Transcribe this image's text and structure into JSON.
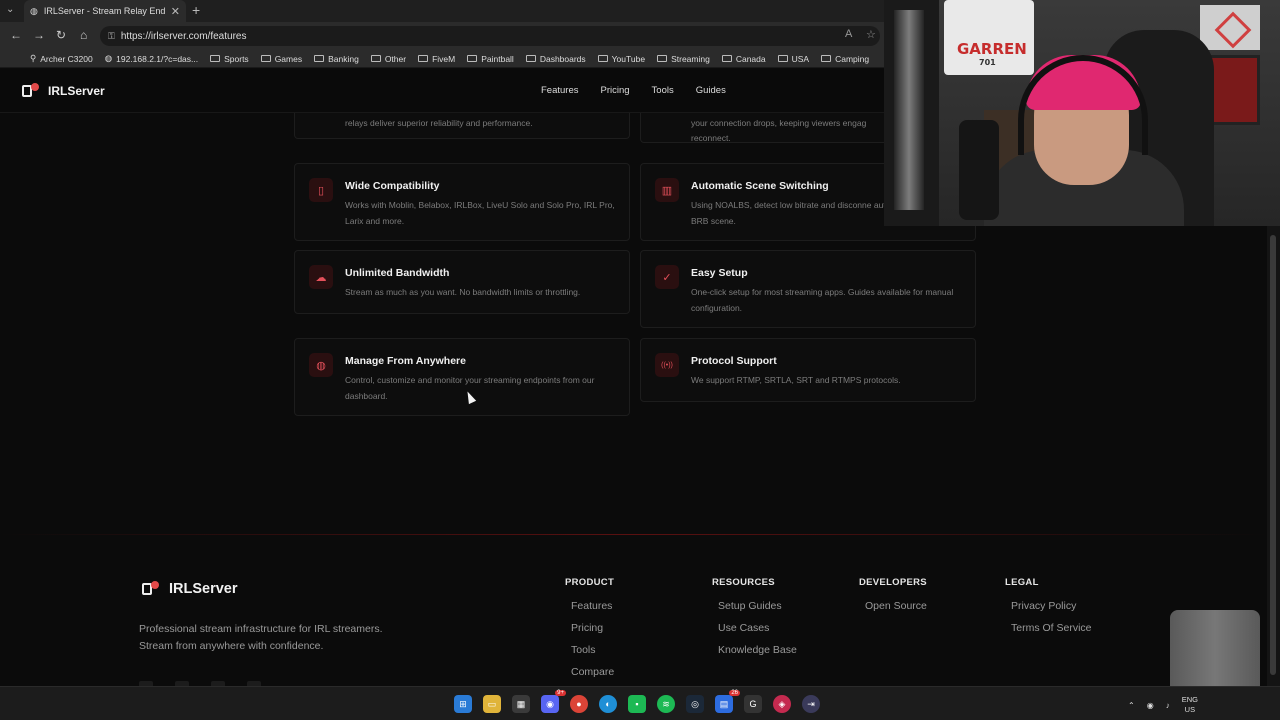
{
  "browser": {
    "tab_title": "IRLServer - Stream Relay Endpoin",
    "url": "https://irlserver.com/features",
    "bookmarks": [
      {
        "label": "Archer C3200",
        "icon": "router-icon"
      },
      {
        "label": "192.168.2.1/?c=das...",
        "icon": "globe-icon"
      },
      {
        "label": "Sports",
        "icon": "folder-icon"
      },
      {
        "label": "Games",
        "icon": "folder-icon"
      },
      {
        "label": "Banking",
        "icon": "folder-icon"
      },
      {
        "label": "Other",
        "icon": "folder-icon"
      },
      {
        "label": "FiveM",
        "icon": "folder-icon"
      },
      {
        "label": "Paintball",
        "icon": "folder-icon"
      },
      {
        "label": "Dashboards",
        "icon": "folder-icon"
      },
      {
        "label": "YouTube",
        "icon": "folder-icon"
      },
      {
        "label": "Streaming",
        "icon": "folder-icon"
      },
      {
        "label": "Canada",
        "icon": "folder-icon"
      },
      {
        "label": "USA",
        "icon": "folder-icon"
      },
      {
        "label": "Camping",
        "icon": "folder-icon"
      }
    ]
  },
  "site": {
    "brand": "IRLServer",
    "menu": [
      "Features",
      "Pricing",
      "Tools",
      "Guides"
    ]
  },
  "features": {
    "partial_top_left": "relays deliver superior reliability and performance.",
    "partial_top_right": [
      "your connection drops, keeping viewers engag",
      "reconnect."
    ],
    "cards": [
      {
        "title": "Wide Compatibility",
        "desc": "Works with Moblin, Belabox, IRLBox, LiveU Solo and Solo Pro, IRL Pro, Larix and more.",
        "icon": "phone-icon",
        "glyph": "▯"
      },
      {
        "title": "Automatic Scene Switching",
        "desc": "Using NOALBS, detect low bitrate and disconne automatically switch to a BRB scene.",
        "icon": "bar-chart-icon",
        "glyph": "▥"
      },
      {
        "title": "Unlimited Bandwidth",
        "desc": "Stream as much as you want. No bandwidth limits or throttling.",
        "icon": "cloud-icon",
        "glyph": "☁"
      },
      {
        "title": "Easy Setup",
        "desc": "One-click setup for most streaming apps. Guides available for manual configuration.",
        "icon": "check-circle-icon",
        "glyph": "✓"
      },
      {
        "title": "Manage From Anywhere",
        "desc": "Control, customize and monitor your streaming endpoints from our dashboard.",
        "icon": "globe-icon",
        "glyph": "◍"
      },
      {
        "title": "Protocol Support",
        "desc": "We support RTMP, SRTLA, SRT and RTMPS protocols.",
        "icon": "broadcast-icon",
        "glyph": "((•))"
      }
    ]
  },
  "footer": {
    "brand": "IRLServer",
    "tagline": "Professional stream infrastructure for IRL streamers. Stream from anywhere with confidence.",
    "columns": [
      {
        "heading": "PRODUCT",
        "links": [
          "Features",
          "Pricing",
          "Tools",
          "Compare"
        ]
      },
      {
        "heading": "RESOURCES",
        "links": [
          "Setup Guides",
          "Use Cases",
          "Knowledge Base"
        ]
      },
      {
        "heading": "DEVELOPERS",
        "links": [
          "Open Source"
        ]
      },
      {
        "heading": "LEGAL",
        "links": [
          "Privacy Policy",
          "Terms Of Service"
        ]
      }
    ]
  },
  "webcam": {
    "poster_text": "GARREN",
    "poster_sub": "701"
  },
  "taskbar": {
    "badge_count_1": "9+",
    "badge_count_2": "26",
    "lang_line1": "ENG",
    "lang_line2": "US"
  },
  "colors": {
    "accent": "#e4505a",
    "bg": "#0b0b0b"
  }
}
